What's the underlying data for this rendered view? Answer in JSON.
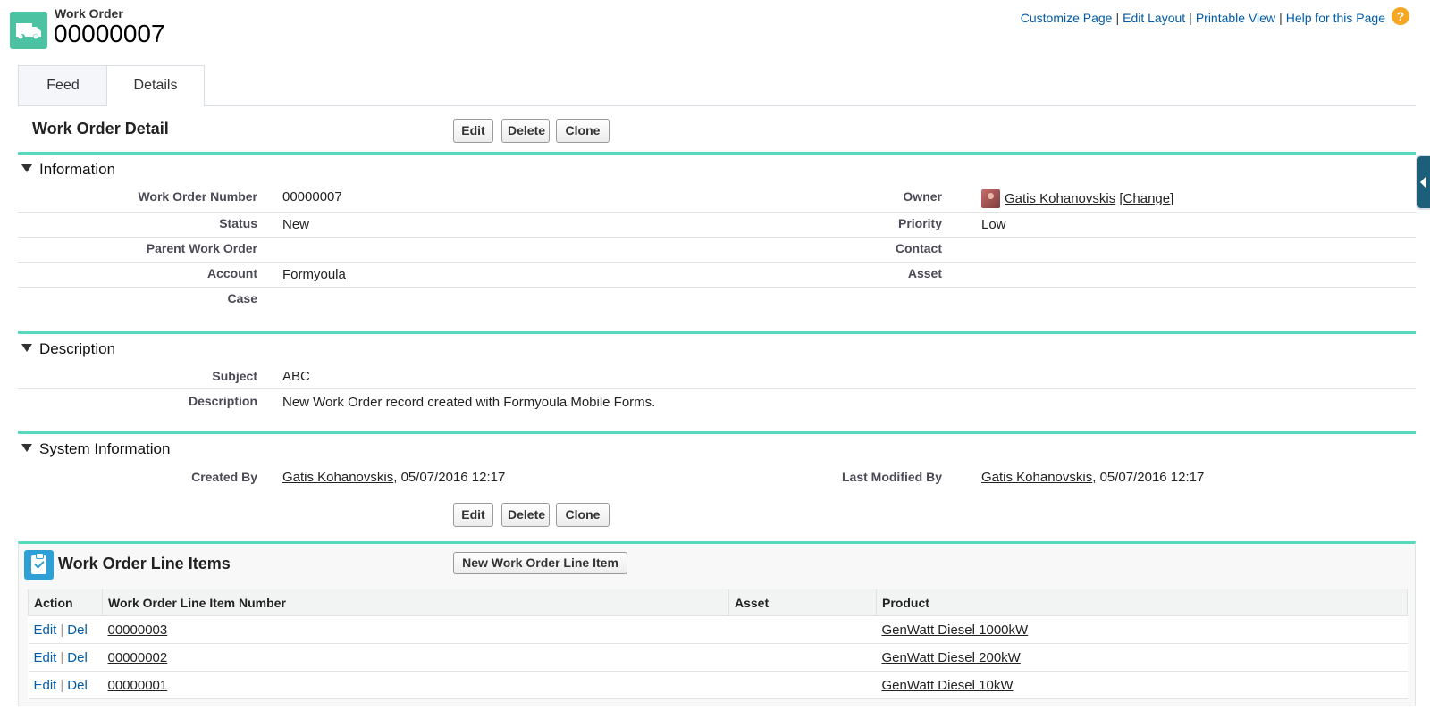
{
  "header": {
    "object_type": "Work Order",
    "record_number": "00000007",
    "links": [
      "Customize Page",
      "Edit Layout",
      "Printable View",
      "Help for this Page"
    ],
    "help_icon": "?"
  },
  "tabs": [
    {
      "label": "Feed"
    },
    {
      "label": "Details"
    }
  ],
  "detail": {
    "title": "Work Order Detail",
    "buttons": {
      "edit": "Edit",
      "delete": "Delete",
      "clone": "Clone"
    }
  },
  "sections": {
    "information": {
      "title": "Information",
      "work_order_number_label": "Work Order Number",
      "work_order_number": "00000007",
      "owner_label": "Owner",
      "owner": "Gatis Kohanovskis",
      "owner_change": "[Change]",
      "status_label": "Status",
      "status": "New",
      "priority_label": "Priority",
      "priority": "Low",
      "parent_label": "Parent Work Order",
      "contact_label": "Contact",
      "account_label": "Account",
      "account": "Formyoula",
      "asset_label": "Asset",
      "case_label": "Case"
    },
    "description": {
      "title": "Description",
      "subject_label": "Subject",
      "subject": "ABC",
      "description_label": "Description",
      "description": "New Work Order record created with Formyoula Mobile Forms."
    },
    "system": {
      "title": "System Information",
      "created_by_label": "Created By",
      "created_by": "Gatis Kohanovskis",
      "created_date": ", 05/07/2016 12:17",
      "modified_by_label": "Last Modified By",
      "modified_by": "Gatis Kohanovskis",
      "modified_date": ", 05/07/2016 12:17"
    }
  },
  "line_items": {
    "title": "Work Order Line Items",
    "new_button": "New Work Order Line Item",
    "columns": {
      "action": "Action",
      "number": "Work Order Line Item Number",
      "asset": "Asset",
      "product": "Product"
    },
    "edit": "Edit",
    "del": "Del",
    "rows": [
      {
        "number": "00000003",
        "asset": "",
        "product": "GenWatt Diesel 1000kW"
      },
      {
        "number": "00000002",
        "asset": "",
        "product": "GenWatt Diesel 200kW"
      },
      {
        "number": "00000001",
        "asset": "",
        "product": "GenWatt Diesel 10kW"
      }
    ]
  }
}
